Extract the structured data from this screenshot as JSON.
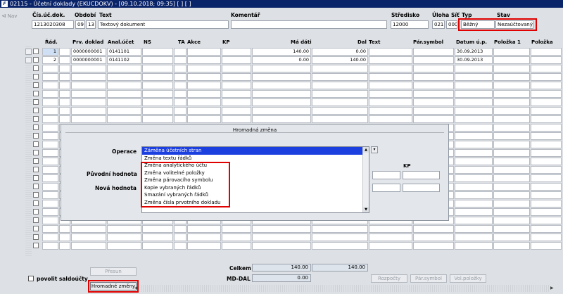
{
  "window": {
    "title": "02115 - Účetní doklady (EKUCDOKV) - [09.10.2018; 09:35]  [ ]  [ ]",
    "icon_text": "F"
  },
  "nav": {
    "label": "Nav"
  },
  "header": {
    "labels": {
      "doc_no": "Čís.úč.dok.",
      "period": "Období",
      "text": "Text",
      "comment": "Komentář",
      "center": "Středisko",
      "task": "Úloha",
      "site": "Síť",
      "type": "Typ",
      "state": "Stav"
    },
    "values": {
      "doc_no": "1213020308",
      "period_a": "09",
      "period_b": "13",
      "text": "Textový dokument",
      "comment": "",
      "center": "12000",
      "task": "021",
      "site": "000",
      "type": "Běžný",
      "state": "Nezaúčtovaný"
    }
  },
  "grid": {
    "columns": [
      "Řád.",
      "Prv. doklad",
      "Anal.účet",
      "NS",
      "TA",
      "Akce",
      "KP",
      "Má dáti",
      "Dal",
      "Text",
      "Pár.symbol",
      "Datum ú.p.",
      "Položka 1",
      "Položka"
    ],
    "rows": [
      {
        "line": "1",
        "doc": "0000000001",
        "account": "0141101",
        "debit": "140.00",
        "credit": "0.00",
        "date": "30.09.2013"
      },
      {
        "line": "2",
        "doc": "0000000001",
        "account": "0141102",
        "debit": "0.00",
        "credit": "140.00",
        "date": "30.09.2013"
      }
    ]
  },
  "dialog": {
    "title": "Hromadná změna",
    "operation_label": "Operace",
    "original_label": "Původní hodnota",
    "new_label": "Nová hodnota",
    "kp_label": "KP",
    "options": [
      "Záměna účetních stran",
      "Změna textu řádků",
      "Změna analytického účtu",
      "Změna volitelné položky",
      "Změna párovacího symbolu",
      "Kopie vybraných řádků",
      "Smazání vybraných řádků",
      "Změna čísla prvotního dokladu"
    ],
    "selected_option": "Záměna účetních stran"
  },
  "footer": {
    "total_label": "Celkem",
    "md_dal_label": "MD-DAL",
    "total_debit": "140.00",
    "total_credit": "140.00",
    "md_dal": "0.00",
    "saldo_label": "povolit saldoúčty",
    "buttons": {
      "presun": "Přesun",
      "hromadne": "Hromadné změny",
      "rozpocty": "Rozpočty",
      "parsymbol": "Pár.symbol",
      "volpolozky": "Vol.položky"
    }
  },
  "colors": {
    "title_bar": "#0a246a",
    "selection": "#1c3fe0",
    "highlight": "#e00000"
  }
}
